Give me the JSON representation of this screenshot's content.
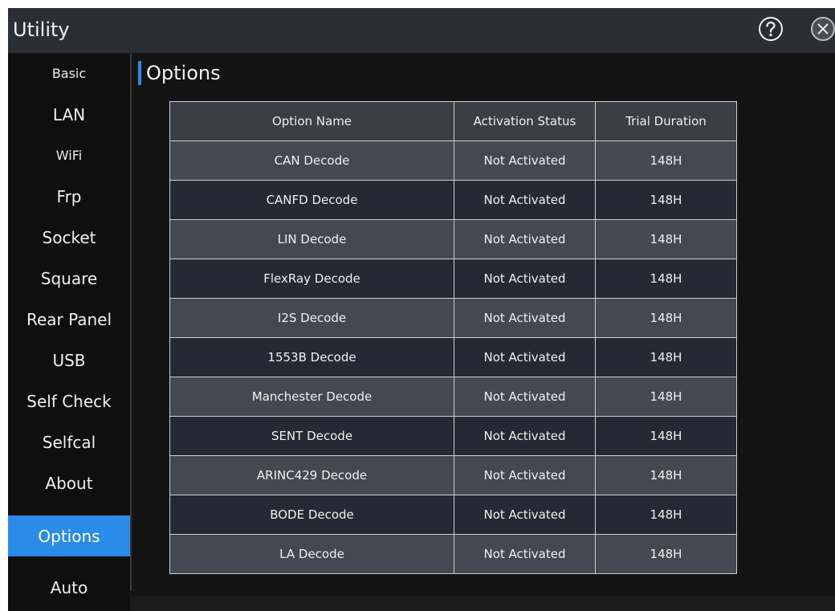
{
  "window": {
    "title": "Utility"
  },
  "icons": {
    "help": "question-circle-icon",
    "close": "close-circle-icon"
  },
  "sidebar": {
    "items": [
      {
        "label": "Basic"
      },
      {
        "label": "LAN"
      },
      {
        "label": "WiFi"
      },
      {
        "label": "Frp"
      },
      {
        "label": "Socket"
      },
      {
        "label": "Square"
      },
      {
        "label": "Rear Panel"
      },
      {
        "label": "USB"
      },
      {
        "label": "Self Check"
      },
      {
        "label": "Selfcal"
      },
      {
        "label": "About"
      },
      {
        "label": "Options"
      },
      {
        "label": "Auto"
      }
    ],
    "active": "Options"
  },
  "main": {
    "title": "Options",
    "table": {
      "headers": [
        "Option Name",
        "Activation Status",
        "Trial Duration"
      ],
      "rows": [
        [
          "CAN Decode",
          "Not Activated",
          "148H"
        ],
        [
          "CANFD Decode",
          "Not Activated",
          "148H"
        ],
        [
          "LIN Decode",
          "Not Activated",
          "148H"
        ],
        [
          "FlexRay Decode",
          "Not Activated",
          "148H"
        ],
        [
          "I2S Decode",
          "Not Activated",
          "148H"
        ],
        [
          "1553B Decode",
          "Not Activated",
          "148H"
        ],
        [
          "Manchester Decode",
          "Not Activated",
          "148H"
        ],
        [
          "SENT Decode",
          "Not Activated",
          "148H"
        ],
        [
          "ARINC429 Decode",
          "Not Activated",
          "148H"
        ],
        [
          "BODE Decode",
          "Not Activated",
          "148H"
        ],
        [
          "LA Decode",
          "Not Activated",
          "148H"
        ]
      ]
    }
  },
  "colors": {
    "accent": "#2b8be8",
    "titlebar": "#2b2f35",
    "background": "#141414"
  }
}
